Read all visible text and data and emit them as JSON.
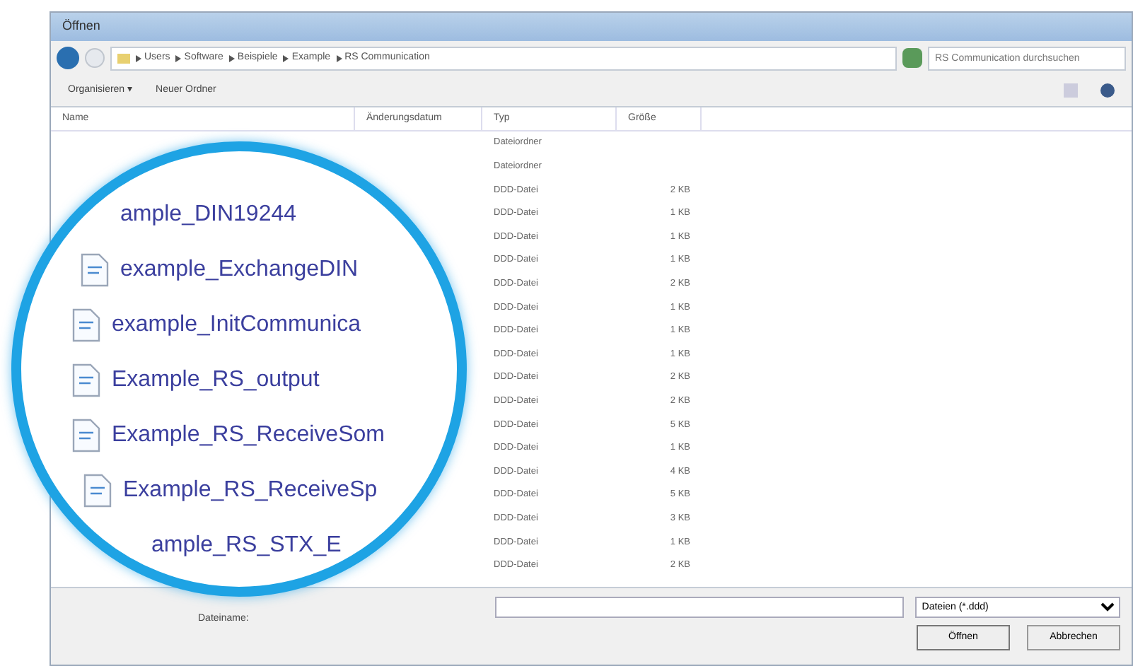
{
  "window": {
    "title": "Öffnen"
  },
  "address": {
    "segments": [
      "Users",
      "Software",
      "Beispiele",
      "Example",
      "RS Communication"
    ]
  },
  "search": {
    "placeholder": "RS Communication durchsuchen"
  },
  "toolbar": {
    "organize": "Organisieren ▾",
    "new_folder": "Neuer Ordner"
  },
  "table": {
    "columns": [
      "Name",
      "Änderungsdatum",
      "Typ",
      "Größe"
    ],
    "rows": [
      {
        "type": "Dateiordner",
        "size": ""
      },
      {
        "type": "Dateiordner",
        "size": ""
      },
      {
        "type": "DDD-Datei",
        "size": "2 KB"
      },
      {
        "type": "DDD-Datei",
        "size": "1 KB"
      },
      {
        "type": "DDD-Datei",
        "size": "1 KB"
      },
      {
        "type": "DDD-Datei",
        "size": "1 KB"
      },
      {
        "type": "DDD-Datei",
        "size": "2 KB"
      },
      {
        "type": "DDD-Datei",
        "size": "1 KB"
      },
      {
        "type": "DDD-Datei",
        "size": "1 KB"
      },
      {
        "type": "DDD-Datei",
        "size": "1 KB"
      },
      {
        "type": "DDD-Datei",
        "size": "2 KB"
      },
      {
        "type": "DDD-Datei",
        "size": "2 KB"
      },
      {
        "type": "DDD-Datei",
        "size": "5 KB"
      },
      {
        "type": "DDD-Datei",
        "size": "1 KB"
      },
      {
        "type": "DDD-Datei",
        "size": "4 KB"
      },
      {
        "type": "DDD-Datei",
        "size": "5 KB"
      },
      {
        "type": "DDD-Datei",
        "size": "3 KB"
      },
      {
        "type": "DDD-Datei",
        "size": "1 KB"
      },
      {
        "type": "DDD-Datei",
        "size": "2 KB"
      }
    ]
  },
  "magnifier": {
    "items": [
      {
        "name": "ample_DIN19244",
        "icon": false
      },
      {
        "name": "example_ExchangeDIN",
        "icon": true
      },
      {
        "name": "example_InitCommunica",
        "icon": true
      },
      {
        "name": "Example_RS_output",
        "icon": true
      },
      {
        "name": "Example_RS_ReceiveSom",
        "icon": true
      },
      {
        "name": "Example_RS_ReceiveSp",
        "icon": true
      },
      {
        "name": "ample_RS_STX_E",
        "icon": false
      }
    ]
  },
  "footer": {
    "filename_label": "Dateiname:",
    "filter": "Dateien (*.ddd)",
    "open": "Öffnen",
    "cancel": "Abbrechen"
  }
}
